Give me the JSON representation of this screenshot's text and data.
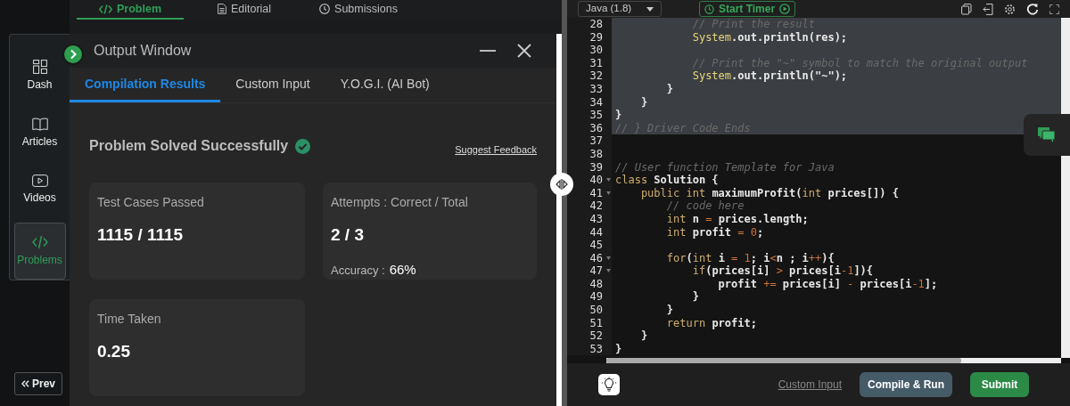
{
  "top_tabs": [
    {
      "label": "Problem",
      "selected": true
    },
    {
      "label": "Editorial",
      "selected": false
    },
    {
      "label": "Submissions",
      "selected": false
    }
  ],
  "sidebar": {
    "items": [
      {
        "label": "Dash",
        "selected": false
      },
      {
        "label": "Articles",
        "selected": false
      },
      {
        "label": "Videos",
        "selected": false
      },
      {
        "label": "Problems",
        "selected": true
      }
    ],
    "prev_button": "Prev"
  },
  "output_window": {
    "title": "Output Window",
    "tabs": [
      {
        "label": "Compilation Results",
        "selected": true
      },
      {
        "label": "Custom Input",
        "selected": false
      },
      {
        "label": "Y.O.G.I. (AI Bot)",
        "selected": false
      }
    ],
    "status": "Problem Solved Successfully",
    "feedback_link": "Suggest Feedback",
    "cards": [
      {
        "label": "Test Cases Passed",
        "value": "1115 / 1115"
      },
      {
        "label": "Attempts : Correct / Total",
        "value": "2 / 3",
        "extra_label": "Accuracy :",
        "extra_value": "66%"
      },
      {
        "label": "Time Taken",
        "value": "0.25"
      }
    ]
  },
  "editor": {
    "language": "Java (1.8)",
    "timer_button": "Start Timer",
    "lines": [
      {
        "number": "28",
        "highlighted": true,
        "foldable": false,
        "tokens": [
          {
            "text": "            // Print the result",
            "kind": "comment"
          }
        ]
      },
      {
        "number": "29",
        "highlighted": true,
        "foldable": false,
        "tokens": [
          {
            "text": "            System",
            "kind": "type"
          },
          {
            "text": ".out.println(res);",
            "kind": "plain"
          }
        ]
      },
      {
        "number": "30",
        "highlighted": true,
        "foldable": false
      },
      {
        "number": "31",
        "highlighted": true,
        "foldable": false,
        "tokens": [
          {
            "text": "            // Print the \"~\" symbol to match the original output",
            "kind": "comment"
          }
        ]
      },
      {
        "number": "32",
        "highlighted": true,
        "foldable": false,
        "tokens": [
          {
            "text": "            System",
            "kind": "type"
          },
          {
            "text": ".out.println(\"~\");",
            "kind": "plain"
          }
        ]
      },
      {
        "number": "33",
        "highlighted": true,
        "foldable": false,
        "tokens": [
          {
            "text": "        }",
            "kind": "plain"
          }
        ]
      },
      {
        "number": "34",
        "highlighted": true,
        "foldable": false,
        "tokens": [
          {
            "text": "    }",
            "kind": "plain"
          }
        ]
      },
      {
        "number": "35",
        "highlighted": true,
        "foldable": false,
        "tokens": [
          {
            "text": "}",
            "kind": "plain"
          }
        ]
      },
      {
        "number": "36",
        "highlighted": true,
        "foldable": false,
        "tokens": [
          {
            "text": "// } Driver Code Ends",
            "kind": "comment"
          }
        ]
      },
      {
        "number": "37",
        "highlighted": false,
        "foldable": false
      },
      {
        "number": "38",
        "highlighted": false,
        "foldable": false
      },
      {
        "number": "39",
        "highlighted": false,
        "foldable": false,
        "tokens": [
          {
            "text": "// User function Template for Java",
            "kind": "comment"
          }
        ]
      },
      {
        "number": "40",
        "highlighted": false,
        "foldable": true,
        "tokens": [
          {
            "text": "class",
            "kind": "keyword"
          },
          {
            "text": " Solution {",
            "kind": "plain"
          }
        ]
      },
      {
        "number": "41",
        "highlighted": false,
        "foldable": true,
        "tokens": [
          {
            "text": "    public",
            "kind": "keyword"
          },
          {
            "text": " int",
            "kind": "keyword"
          },
          {
            "text": " maximumProfit(",
            "kind": "plain"
          },
          {
            "text": "int",
            "kind": "keyword"
          },
          {
            "text": " prices[]) {",
            "kind": "plain"
          }
        ]
      },
      {
        "number": "42",
        "highlighted": false,
        "foldable": false,
        "tokens": [
          {
            "text": "        // code here",
            "kind": "comment"
          }
        ]
      },
      {
        "number": "43",
        "highlighted": false,
        "foldable": false,
        "tokens": [
          {
            "text": "        int",
            "kind": "keyword"
          },
          {
            "text": " n ",
            "kind": "plain"
          },
          {
            "text": "=",
            "kind": "operator"
          },
          {
            "text": " prices.length;",
            "kind": "plain"
          }
        ]
      },
      {
        "number": "44",
        "highlighted": false,
        "foldable": false,
        "tokens": [
          {
            "text": "        int",
            "kind": "keyword"
          },
          {
            "text": " profit ",
            "kind": "plain"
          },
          {
            "text": "=",
            "kind": "operator"
          },
          {
            "text": " 0",
            "kind": "number"
          },
          {
            "text": ";",
            "kind": "plain"
          }
        ]
      },
      {
        "number": "45",
        "highlighted": false,
        "foldable": false
      },
      {
        "number": "46",
        "highlighted": false,
        "foldable": true,
        "tokens": [
          {
            "text": "        for",
            "kind": "keyword"
          },
          {
            "text": "(",
            "kind": "plain"
          },
          {
            "text": "int",
            "kind": "keyword"
          },
          {
            "text": " i ",
            "kind": "plain"
          },
          {
            "text": "=",
            "kind": "operator"
          },
          {
            "text": " 1",
            "kind": "number"
          },
          {
            "text": "; i",
            "kind": "plain"
          },
          {
            "text": "<",
            "kind": "operator"
          },
          {
            "text": "n ; i",
            "kind": "plain"
          },
          {
            "text": "++",
            "kind": "operator"
          },
          {
            "text": "){",
            "kind": "plain"
          }
        ]
      },
      {
        "number": "47",
        "highlighted": false,
        "foldable": true,
        "tokens": [
          {
            "text": "            if",
            "kind": "keyword"
          },
          {
            "text": "(prices[i] ",
            "kind": "plain"
          },
          {
            "text": ">",
            "kind": "operator"
          },
          {
            "text": " prices[i",
            "kind": "plain"
          },
          {
            "text": "-",
            "kind": "operator"
          },
          {
            "text": "1",
            "kind": "number"
          },
          {
            "text": "]){",
            "kind": "plain"
          }
        ]
      },
      {
        "number": "48",
        "highlighted": false,
        "foldable": false,
        "tokens": [
          {
            "text": "                profit ",
            "kind": "plain"
          },
          {
            "text": "+=",
            "kind": "operator"
          },
          {
            "text": " prices[i] ",
            "kind": "plain"
          },
          {
            "text": "-",
            "kind": "operator"
          },
          {
            "text": " prices[i",
            "kind": "plain"
          },
          {
            "text": "-",
            "kind": "operator"
          },
          {
            "text": "1",
            "kind": "number"
          },
          {
            "text": "];",
            "kind": "plain"
          }
        ]
      },
      {
        "number": "49",
        "highlighted": false,
        "foldable": false,
        "tokens": [
          {
            "text": "            }",
            "kind": "plain"
          }
        ]
      },
      {
        "number": "50",
        "highlighted": false,
        "foldable": false,
        "tokens": [
          {
            "text": "        }",
            "kind": "plain"
          }
        ]
      },
      {
        "number": "51",
        "highlighted": false,
        "foldable": false,
        "tokens": [
          {
            "text": "        return",
            "kind": "keyword"
          },
          {
            "text": " profit;",
            "kind": "plain"
          }
        ]
      },
      {
        "number": "52",
        "highlighted": false,
        "foldable": false,
        "tokens": [
          {
            "text": "    }",
            "kind": "plain"
          }
        ]
      },
      {
        "number": "53",
        "highlighted": false,
        "foldable": false,
        "tokens": [
          {
            "text": "}",
            "kind": "plain"
          }
        ]
      }
    ],
    "footer": {
      "custom_input_link": "Custom Input",
      "compile_button": "Compile & Run",
      "submit_button": "Submit"
    }
  }
}
